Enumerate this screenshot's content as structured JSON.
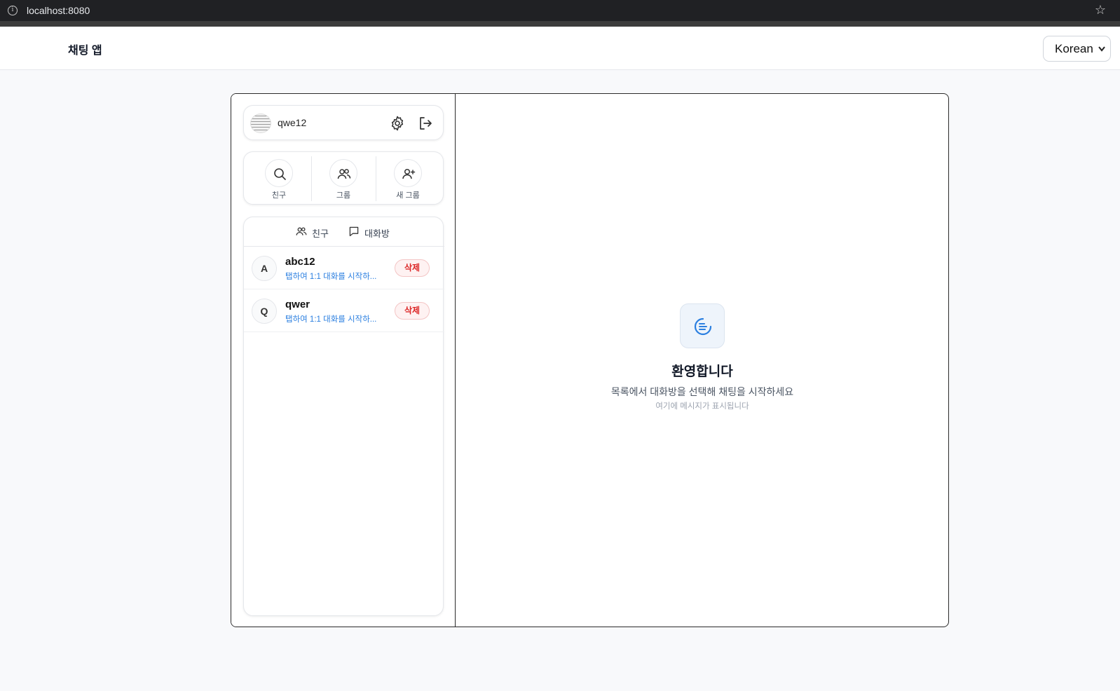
{
  "browser": {
    "url": "localhost:8080"
  },
  "header": {
    "title": "채팅 앱",
    "language": "Korean"
  },
  "profile": {
    "username": "qwe12"
  },
  "actions": [
    {
      "label": "친구",
      "icon": "search-icon"
    },
    {
      "label": "그룹",
      "icon": "users-icon"
    },
    {
      "label": "새 그룹",
      "icon": "user-plus-icon"
    }
  ],
  "tabs": [
    {
      "label": "친구",
      "icon": "users-icon"
    },
    {
      "label": "대화방",
      "icon": "chat-bubble-icon"
    }
  ],
  "friends": [
    {
      "initial": "A",
      "name": "abc12",
      "hint": "탭하여 1:1 대화를 시작하...",
      "delete_label": "삭제"
    },
    {
      "initial": "Q",
      "name": "qwer",
      "hint": "탭하여 1:1 대화를 시작하...",
      "delete_label": "삭제"
    }
  ],
  "welcome": {
    "title": "환영합니다",
    "subtitle": "목록에서 대화방을 선택해 채팅을 시작하세요",
    "hint": "여기에 메시지가 표시됩니다"
  },
  "colors": {
    "accent": "#2b7fe0",
    "danger": "#dc2626",
    "background": "#f8f9fb"
  }
}
